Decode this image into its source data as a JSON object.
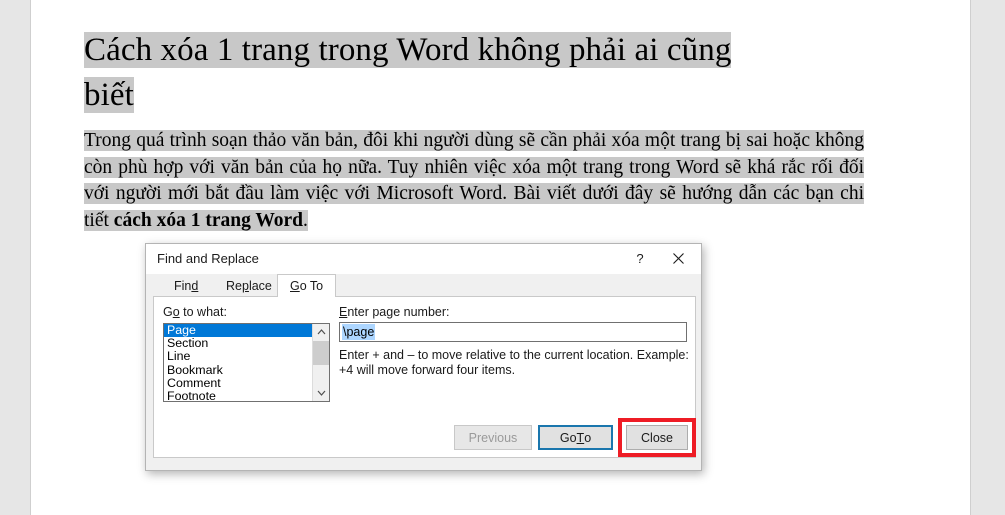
{
  "document": {
    "title_line1": "Cách xóa 1 trang trong Word không phải ai cũng",
    "title_line2": "biết",
    "paragraph_part1": "Trong quá trình soạn thảo văn bản, đôi khi người dùng sẽ cần phải xóa một trang bị sai hoặc không còn phù hợp với văn bản của họ nữa. Tuy nhiên việc xóa một trang trong Word sẽ khá rắc rối đối với người mới bắt đầu làm việc với Microsoft Word. Bài viết dưới đây sẽ hướng dẫn các bạn chi tiết ",
    "paragraph_bold": "cách xóa 1 trang Word",
    "paragraph_part2": "."
  },
  "dialog": {
    "title": "Find and Replace",
    "help_icon": "?",
    "close_icon": "×",
    "tabs": [
      {
        "label_pre": "Fin",
        "label_accel": "d",
        "label_post": ""
      },
      {
        "label_pre": "Re",
        "label_accel": "p",
        "label_post": "lace"
      },
      {
        "label_pre": "",
        "label_accel": "G",
        "label_post": "o To"
      }
    ],
    "goto_what_label_pre": "G",
    "goto_what_label_accel": "o",
    "goto_what_label_post": " to what:",
    "goto_what_items": [
      "Page",
      "Section",
      "Line",
      "Bookmark",
      "Comment",
      "Footnote"
    ],
    "selected_item": "Page",
    "scroll_up_icon": "⌃",
    "scroll_down_icon": "⌄",
    "page_number_label_accel": "E",
    "page_number_label_post": "nter page number:",
    "page_number_value": "\\page",
    "hint": "Enter + and – to move relative to the current location. Example: +4 will move forward four items.",
    "buttons": {
      "previous": "Previous",
      "goto_pre": "Go ",
      "goto_accel": "T",
      "goto_post": "o",
      "close": "Close"
    }
  },
  "colors": {
    "selection_blue": "#0078d7",
    "text_selection_blue": "#add6ff",
    "focus_border_blue": "#1a76ad",
    "annotation_red": "#ee1c25",
    "doc_highlight_gray": "#c8c8c8"
  }
}
